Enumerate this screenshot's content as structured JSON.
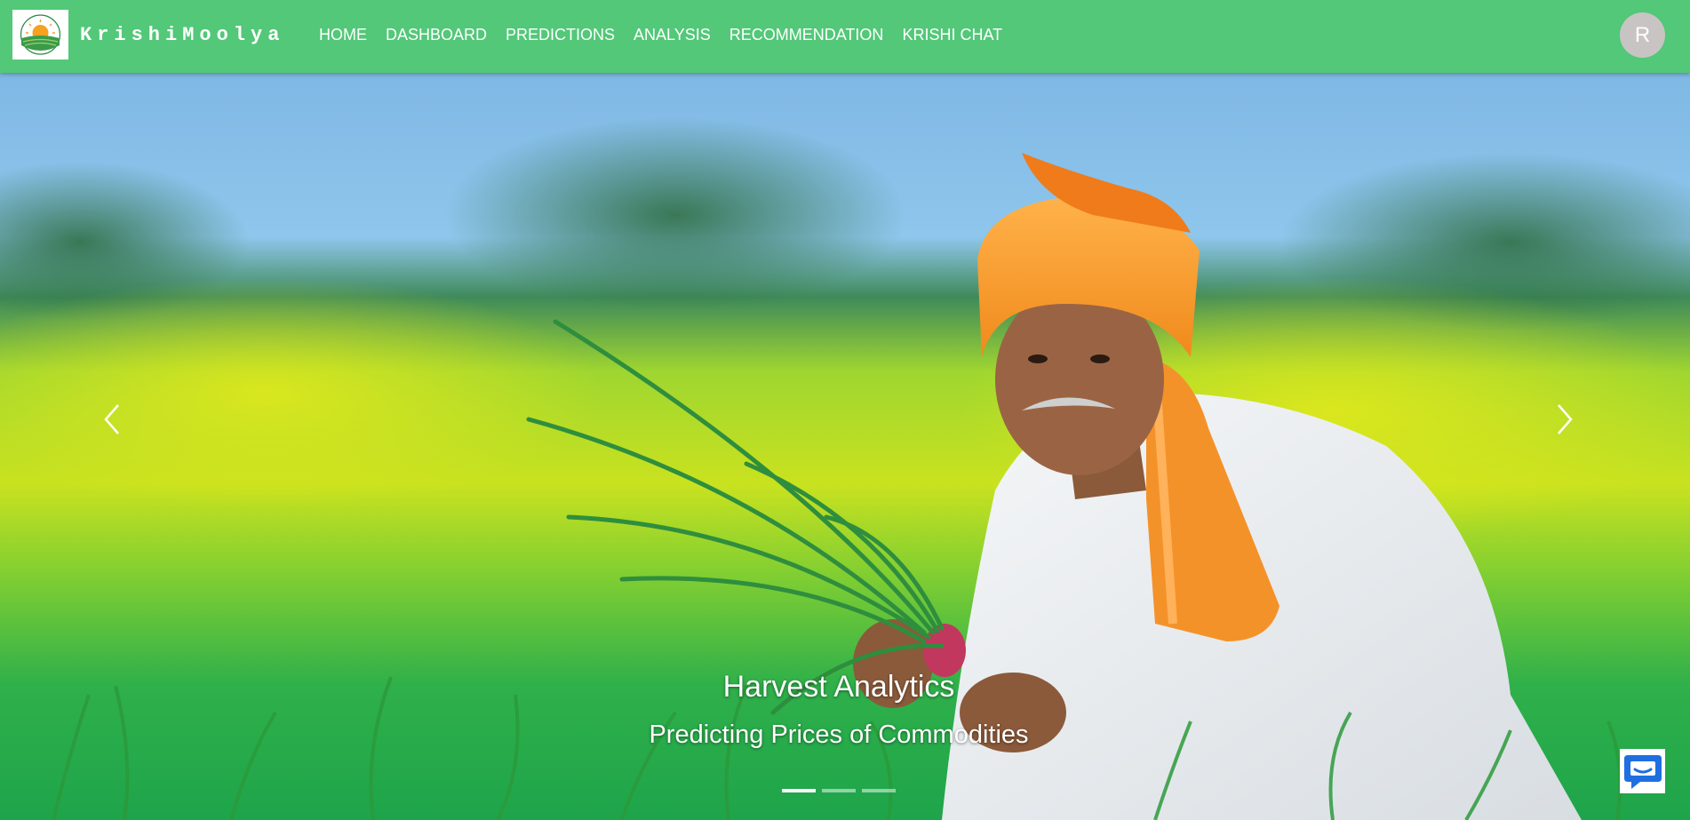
{
  "brand": {
    "name": "KrishiMoolya",
    "logo_icon": "krishimoolya-logo-icon"
  },
  "nav": {
    "items": [
      {
        "label": "HOME"
      },
      {
        "label": "DASHBOARD"
      },
      {
        "label": "PREDICTIONS"
      },
      {
        "label": "ANALYSIS"
      },
      {
        "label": "RECOMMENDATION"
      },
      {
        "label": "KRISHI CHAT"
      }
    ]
  },
  "user": {
    "avatar_initial": "R"
  },
  "carousel": {
    "caption_title": "Harvest Analytics",
    "caption_subtitle": "Predicting Prices of Commodities",
    "prev_icon": "chevron-left-icon",
    "next_icon": "chevron-right-icon",
    "indicator_count": 3,
    "active_indicator": 0,
    "image_subject": "farmer holding spring onions in a green field"
  },
  "chat_widget": {
    "icon": "chat-bubble-icon"
  },
  "colors": {
    "navbar": "#52c878",
    "nav_text": "#ffffff",
    "avatar": "#c8c4c4",
    "chat_icon": "#1f6fe0"
  }
}
